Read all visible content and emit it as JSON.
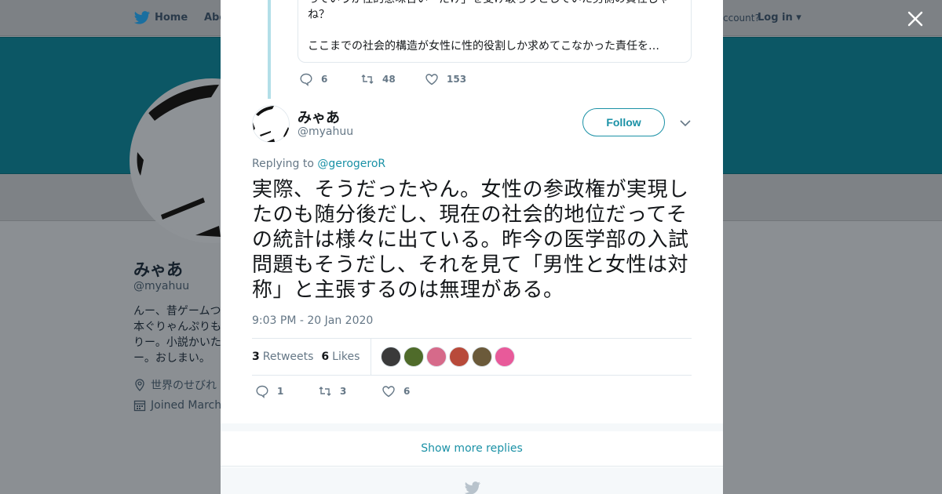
{
  "background": {
    "nav": {
      "home": "Home",
      "about": "Abo",
      "account": "ccount?",
      "login": "Log in"
    },
    "profile": {
      "name": "みゃあ",
      "handle": "@myahuu",
      "bio_lines": [
        "んー、昔ゲームつ",
        "本ぐりゃんぷりも",
        "りー。小説かいた",
        "ー。おしまい。"
      ],
      "location": "世界のせびれ",
      "joined": "Joined March"
    },
    "colors": {
      "banner": "#0c5765",
      "overlay": "#8b8f93"
    }
  },
  "modal": {
    "previous_tweet": {
      "text_top": "っていうか性的意味合い「だけ」を受け取ろうとしていた男側の責任じゃね？",
      "text_bottom": "ここまでの社会的構造が女性に性的役割しか求めてこなかった責任を…",
      "replies": "6",
      "retweets": "48",
      "likes": "153"
    },
    "tweet": {
      "author_name": "みゃあ",
      "author_handle": "@myahuu",
      "follow_label": "Follow",
      "replying_prefix": "Replying to",
      "replying_to": "@gerogeroR",
      "text": "実際、そうだったやん。女性の参政権が実現したのも随分後だし、現在の社会的地位だってその統計は様々に出ている。昨今の医学部の入試問題もそうだし、それを見て「男性と女性は対称」と主張するのは無理がある。",
      "timestamp": "9:03 PM - 20 Jan 2020",
      "retweet_count": "3",
      "retweet_label": "Retweets",
      "like_count": "6",
      "like_label": "Likes",
      "likers": [
        "#3a3a3a",
        "#4f6b2a",
        "#d66a8a",
        "#b84a3a",
        "#6b5a3a",
        "#e85a9a"
      ],
      "replies": "1",
      "retweets": "3",
      "likes": "6"
    },
    "show_more_label": "Show more replies",
    "colors": {
      "accent": "#1a91a6",
      "muted": "#657786"
    }
  }
}
